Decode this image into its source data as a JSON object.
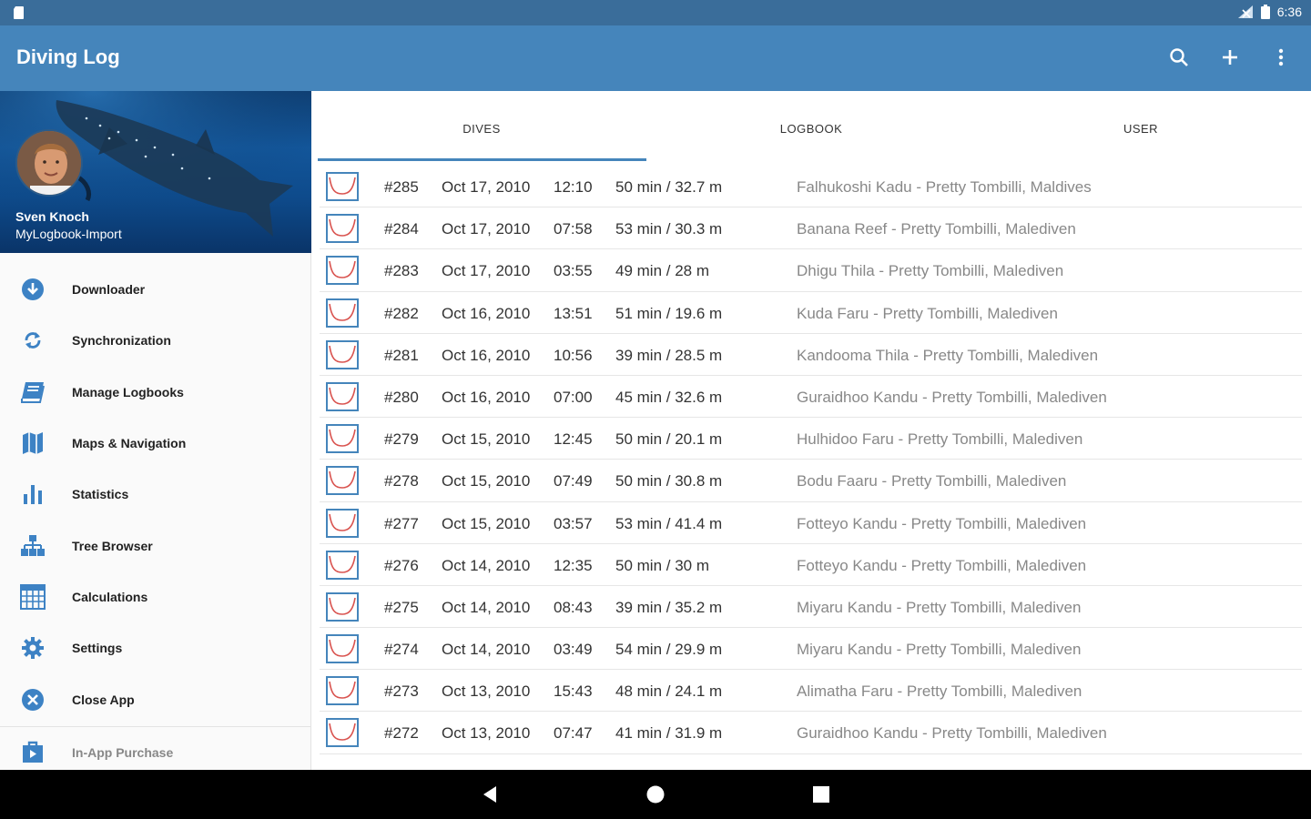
{
  "status_bar": {
    "time": "6:36",
    "icons": [
      "sd-card-icon",
      "no-signal-icon",
      "battery-icon"
    ]
  },
  "app_bar": {
    "title": "Diving Log",
    "actions": [
      "search-icon",
      "add-icon",
      "more-vert-icon"
    ]
  },
  "drawer": {
    "user_name": "Sven Knoch",
    "account": "MyLogbook-Import",
    "items": [
      {
        "label": "Downloader",
        "icon": "download-icon"
      },
      {
        "label": "Synchronization",
        "icon": "sync-icon"
      },
      {
        "label": "Manage Logbooks",
        "icon": "book-icon"
      },
      {
        "label": "Maps & Navigation",
        "icon": "map-icon"
      },
      {
        "label": "Statistics",
        "icon": "bar-chart-icon"
      },
      {
        "label": "Tree Browser",
        "icon": "tree-icon"
      },
      {
        "label": "Calculations",
        "icon": "calculator-icon"
      },
      {
        "label": "Settings",
        "icon": "gear-icon"
      },
      {
        "label": "Close App",
        "icon": "close-circle-icon"
      }
    ],
    "in_app_purchase": {
      "label": "In-App Purchase",
      "icon": "shopping-bag-icon"
    }
  },
  "tabs": {
    "items": [
      "DIVES",
      "LOGBOOK",
      "USER"
    ],
    "active": "DIVES"
  },
  "dives": [
    {
      "num": "#285",
      "date": "Oct 17, 2010",
      "time": "12:10",
      "dur": "50 min / 32.7 m",
      "loc": "Falhukoshi Kadu - Pretty Tombilli, Maldives"
    },
    {
      "num": "#284",
      "date": "Oct 17, 2010",
      "time": "07:58",
      "dur": "53 min / 30.3 m",
      "loc": "Banana Reef - Pretty Tombilli, Malediven"
    },
    {
      "num": "#283",
      "date": "Oct 17, 2010",
      "time": "03:55",
      "dur": "49 min / 28 m",
      "loc": "Dhigu Thila - Pretty Tombilli, Malediven"
    },
    {
      "num": "#282",
      "date": "Oct 16, 2010",
      "time": "13:51",
      "dur": "51 min / 19.6 m",
      "loc": "Kuda Faru - Pretty Tombilli, Malediven"
    },
    {
      "num": "#281",
      "date": "Oct 16, 2010",
      "time": "10:56",
      "dur": "39 min / 28.5 m",
      "loc": "Kandooma Thila - Pretty Tombilli, Malediven"
    },
    {
      "num": "#280",
      "date": "Oct 16, 2010",
      "time": "07:00",
      "dur": "45 min / 32.6 m",
      "loc": "Guraidhoo Kandu - Pretty Tombilli, Malediven"
    },
    {
      "num": "#279",
      "date": "Oct 15, 2010",
      "time": "12:45",
      "dur": "50 min / 20.1 m",
      "loc": "Hulhidoo Faru - Pretty Tombilli, Malediven"
    },
    {
      "num": "#278",
      "date": "Oct 15, 2010",
      "time": "07:49",
      "dur": "50 min / 30.8 m",
      "loc": "Bodu Faaru - Pretty Tombilli, Malediven"
    },
    {
      "num": "#277",
      "date": "Oct 15, 2010",
      "time": "03:57",
      "dur": "53 min / 41.4 m",
      "loc": "Fotteyo Kandu - Pretty Tombilli, Malediven"
    },
    {
      "num": "#276",
      "date": "Oct 14, 2010",
      "time": "12:35",
      "dur": "50 min / 30 m",
      "loc": "Fotteyo Kandu - Pretty Tombilli, Malediven"
    },
    {
      "num": "#275",
      "date": "Oct 14, 2010",
      "time": "08:43",
      "dur": "39 min / 35.2 m",
      "loc": "Miyaru Kandu - Pretty Tombilli, Malediven"
    },
    {
      "num": "#274",
      "date": "Oct 14, 2010",
      "time": "03:49",
      "dur": "54 min / 29.9 m",
      "loc": "Miyaru Kandu - Pretty Tombilli, Malediven"
    },
    {
      "num": "#273",
      "date": "Oct 13, 2010",
      "time": "15:43",
      "dur": "48 min / 24.1 m",
      "loc": "Alimatha Faru - Pretty Tombilli, Malediven"
    },
    {
      "num": "#272",
      "date": "Oct 13, 2010",
      "time": "07:47",
      "dur": "41 min / 31.9 m",
      "loc": "Guraidhoo Kandu - Pretty Tombilli, Malediven"
    }
  ],
  "colors": {
    "status_bar": "#3a6d9a",
    "app_bar": "#4585bb",
    "accent": "#4585bb",
    "graph_line": "#d9534f"
  },
  "nav_bar": [
    "back-icon",
    "home-icon",
    "recents-icon"
  ]
}
